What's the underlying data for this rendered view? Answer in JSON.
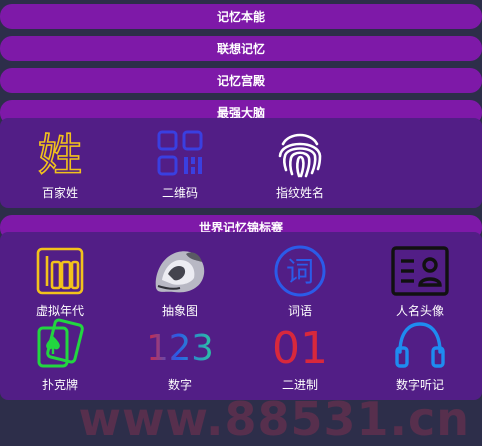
{
  "menu": [
    {
      "label": "记忆本能"
    },
    {
      "label": "联想记忆"
    },
    {
      "label": "记忆宫殿"
    },
    {
      "label": "最强大脑"
    }
  ],
  "group1": {
    "items": [
      {
        "label": "百家姓",
        "icon": "surname-glyph-icon",
        "glyph": "姓"
      },
      {
        "label": "二维码",
        "icon": "qr-code-icon"
      },
      {
        "label": "指纹姓名",
        "icon": "fingerprint-icon"
      }
    ]
  },
  "section2": {
    "title": "世界记忆锦标赛"
  },
  "group2": {
    "items": [
      {
        "label": "虚拟年代",
        "icon": "abacus-icon"
      },
      {
        "label": "抽象图",
        "icon": "abstract-image-icon"
      },
      {
        "label": "词语",
        "icon": "word-circle-icon",
        "glyph": "词"
      },
      {
        "label": "人名头像",
        "icon": "id-card-icon"
      },
      {
        "label": "扑克牌",
        "icon": "playing-cards-icon"
      },
      {
        "label": "数字",
        "icon": "numbers-icon",
        "glyph": "123"
      },
      {
        "label": "二进制",
        "icon": "binary-icon",
        "glyph": "01"
      },
      {
        "label": "数字听记",
        "icon": "headphones-icon"
      }
    ]
  },
  "watermark": "www.88531.cn",
  "colors": {
    "background": "#2d2e4a",
    "pill": "#7e19a8",
    "panel": "#521e86",
    "gold": "#f2c21c",
    "blue": "#3a3fe0",
    "green": "#22d640",
    "red": "#d8283c",
    "cyan": "#1e8cf0"
  }
}
